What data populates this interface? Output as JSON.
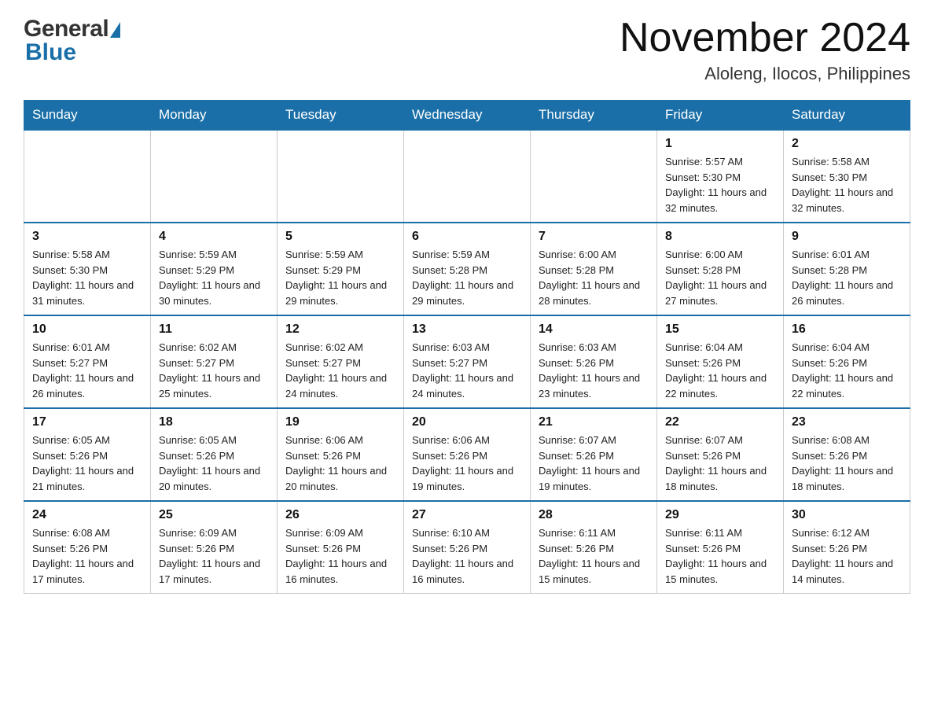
{
  "header": {
    "logo_general": "General",
    "logo_blue": "Blue",
    "title": "November 2024",
    "subtitle": "Aloleng, Ilocos, Philippines"
  },
  "calendar": {
    "days_of_week": [
      "Sunday",
      "Monday",
      "Tuesday",
      "Wednesday",
      "Thursday",
      "Friday",
      "Saturday"
    ],
    "weeks": [
      {
        "days": [
          {
            "number": "",
            "info": ""
          },
          {
            "number": "",
            "info": ""
          },
          {
            "number": "",
            "info": ""
          },
          {
            "number": "",
            "info": ""
          },
          {
            "number": "",
            "info": ""
          },
          {
            "number": "1",
            "info": "Sunrise: 5:57 AM\nSunset: 5:30 PM\nDaylight: 11 hours and 32 minutes."
          },
          {
            "number": "2",
            "info": "Sunrise: 5:58 AM\nSunset: 5:30 PM\nDaylight: 11 hours and 32 minutes."
          }
        ]
      },
      {
        "days": [
          {
            "number": "3",
            "info": "Sunrise: 5:58 AM\nSunset: 5:30 PM\nDaylight: 11 hours and 31 minutes."
          },
          {
            "number": "4",
            "info": "Sunrise: 5:59 AM\nSunset: 5:29 PM\nDaylight: 11 hours and 30 minutes."
          },
          {
            "number": "5",
            "info": "Sunrise: 5:59 AM\nSunset: 5:29 PM\nDaylight: 11 hours and 29 minutes."
          },
          {
            "number": "6",
            "info": "Sunrise: 5:59 AM\nSunset: 5:28 PM\nDaylight: 11 hours and 29 minutes."
          },
          {
            "number": "7",
            "info": "Sunrise: 6:00 AM\nSunset: 5:28 PM\nDaylight: 11 hours and 28 minutes."
          },
          {
            "number": "8",
            "info": "Sunrise: 6:00 AM\nSunset: 5:28 PM\nDaylight: 11 hours and 27 minutes."
          },
          {
            "number": "9",
            "info": "Sunrise: 6:01 AM\nSunset: 5:28 PM\nDaylight: 11 hours and 26 minutes."
          }
        ]
      },
      {
        "days": [
          {
            "number": "10",
            "info": "Sunrise: 6:01 AM\nSunset: 5:27 PM\nDaylight: 11 hours and 26 minutes."
          },
          {
            "number": "11",
            "info": "Sunrise: 6:02 AM\nSunset: 5:27 PM\nDaylight: 11 hours and 25 minutes."
          },
          {
            "number": "12",
            "info": "Sunrise: 6:02 AM\nSunset: 5:27 PM\nDaylight: 11 hours and 24 minutes."
          },
          {
            "number": "13",
            "info": "Sunrise: 6:03 AM\nSunset: 5:27 PM\nDaylight: 11 hours and 24 minutes."
          },
          {
            "number": "14",
            "info": "Sunrise: 6:03 AM\nSunset: 5:26 PM\nDaylight: 11 hours and 23 minutes."
          },
          {
            "number": "15",
            "info": "Sunrise: 6:04 AM\nSunset: 5:26 PM\nDaylight: 11 hours and 22 minutes."
          },
          {
            "number": "16",
            "info": "Sunrise: 6:04 AM\nSunset: 5:26 PM\nDaylight: 11 hours and 22 minutes."
          }
        ]
      },
      {
        "days": [
          {
            "number": "17",
            "info": "Sunrise: 6:05 AM\nSunset: 5:26 PM\nDaylight: 11 hours and 21 minutes."
          },
          {
            "number": "18",
            "info": "Sunrise: 6:05 AM\nSunset: 5:26 PM\nDaylight: 11 hours and 20 minutes."
          },
          {
            "number": "19",
            "info": "Sunrise: 6:06 AM\nSunset: 5:26 PM\nDaylight: 11 hours and 20 minutes."
          },
          {
            "number": "20",
            "info": "Sunrise: 6:06 AM\nSunset: 5:26 PM\nDaylight: 11 hours and 19 minutes."
          },
          {
            "number": "21",
            "info": "Sunrise: 6:07 AM\nSunset: 5:26 PM\nDaylight: 11 hours and 19 minutes."
          },
          {
            "number": "22",
            "info": "Sunrise: 6:07 AM\nSunset: 5:26 PM\nDaylight: 11 hours and 18 minutes."
          },
          {
            "number": "23",
            "info": "Sunrise: 6:08 AM\nSunset: 5:26 PM\nDaylight: 11 hours and 18 minutes."
          }
        ]
      },
      {
        "days": [
          {
            "number": "24",
            "info": "Sunrise: 6:08 AM\nSunset: 5:26 PM\nDaylight: 11 hours and 17 minutes."
          },
          {
            "number": "25",
            "info": "Sunrise: 6:09 AM\nSunset: 5:26 PM\nDaylight: 11 hours and 17 minutes."
          },
          {
            "number": "26",
            "info": "Sunrise: 6:09 AM\nSunset: 5:26 PM\nDaylight: 11 hours and 16 minutes."
          },
          {
            "number": "27",
            "info": "Sunrise: 6:10 AM\nSunset: 5:26 PM\nDaylight: 11 hours and 16 minutes."
          },
          {
            "number": "28",
            "info": "Sunrise: 6:11 AM\nSunset: 5:26 PM\nDaylight: 11 hours and 15 minutes."
          },
          {
            "number": "29",
            "info": "Sunrise: 6:11 AM\nSunset: 5:26 PM\nDaylight: 11 hours and 15 minutes."
          },
          {
            "number": "30",
            "info": "Sunrise: 6:12 AM\nSunset: 5:26 PM\nDaylight: 11 hours and 14 minutes."
          }
        ]
      }
    ]
  }
}
